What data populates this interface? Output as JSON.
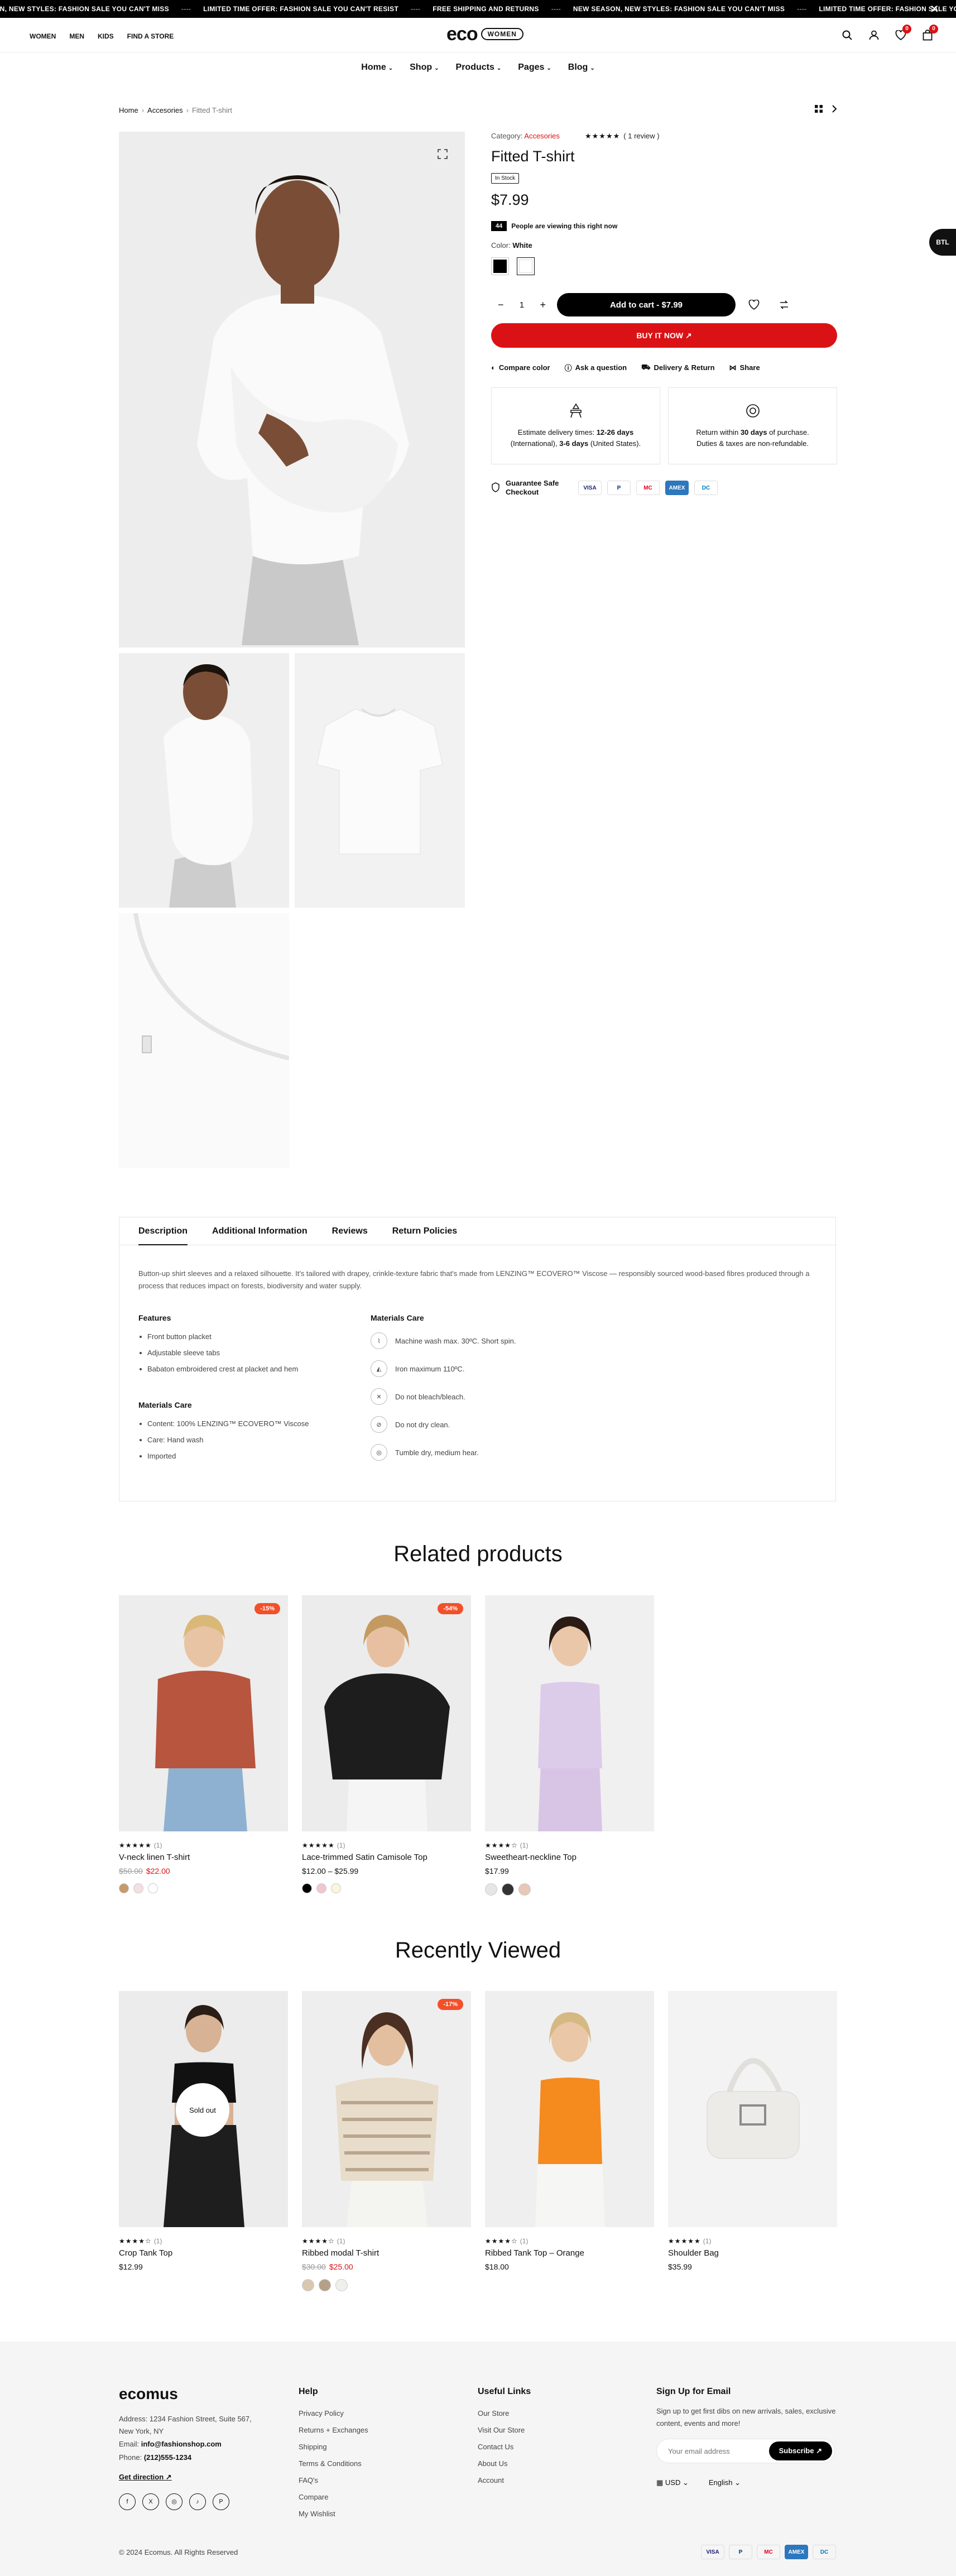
{
  "announcement": {
    "items": [
      "ON, NEW STYLES: FASHION SALE YOU CAN'T MISS",
      "LIMITED TIME OFFER: FASHION SALE YOU CAN'T RESIST",
      "FREE SHIPPING AND RETURNS",
      "NEW SEASON, NEW STYLES: FASHION SALE YOU CAN'T MISS",
      "LIMITED TIME OFFER: FASHION SALE YOU CAN'T"
    ],
    "separator": "----",
    "close": "✕"
  },
  "header": {
    "top_links": [
      "WOMEN",
      "MEN",
      "KIDS",
      "FIND A STORE"
    ],
    "logo_main": "eco",
    "logo_pill": "WOMEN",
    "wishlist_count": "0",
    "cart_count": "0"
  },
  "main_nav": [
    "Home",
    "Shop",
    "Products",
    "Pages",
    "Blog"
  ],
  "breadcrumb": {
    "home": "Home",
    "category": "Accesories",
    "current": "Fitted T-shirt"
  },
  "product": {
    "category_label": "Category:",
    "category": "Accesories",
    "stars": "★★★★★",
    "reviews": "( 1 review )",
    "title": "Fitted T-shirt",
    "stock": "In Stock",
    "price": "$7.99",
    "viewing_count": "44",
    "viewing_text": "People are viewing this right now",
    "color_label": "Color:",
    "color_value": "White",
    "colors": [
      "#000000",
      "#ffffff"
    ],
    "qty": "1",
    "add_to_cart": "Add to cart - $7.99",
    "buy_now": "BUY IT NOW",
    "extras": [
      "Compare color",
      "Ask a question",
      "Delivery & Return",
      "Share"
    ],
    "delivery_text_1": "Estimate delivery times:",
    "delivery_bold_1": "12-26 days",
    "delivery_text_2": "(International),",
    "delivery_bold_2": "3-6 days",
    "delivery_text_3": "(United States).",
    "return_text_1": "Return within",
    "return_bold": "30 days",
    "return_text_2": "of purchase. Duties & taxes are non-refundable.",
    "safe_checkout": "Guarantee Safe Checkout",
    "pay_cards": [
      "VISA",
      "P",
      "MC",
      "AMEX",
      "DC"
    ]
  },
  "side_badge": "BTL",
  "tabs": {
    "labels": [
      "Description",
      "Additional Information",
      "Reviews",
      "Return Policies"
    ],
    "description": "Button-up shirt sleeves and a relaxed silhouette. It's tailored with drapey, crinkle-texture fabric that's made from LENZING™ ECOVERO™ Viscose — responsibly sourced wood-based fibres produced through a process that reduces impact on forests, biodiversity and water supply.",
    "features_title": "Features",
    "features": [
      "Front button placket",
      "Adjustable sleeve tabs",
      "Babaton embroidered crest at placket and hem"
    ],
    "materials_title": "Materials Care",
    "materials": [
      "Content: 100% LENZING™ ECOVERO™ Viscose",
      "Care: Hand wash",
      "Imported"
    ],
    "care_title": "Materials Care",
    "care": [
      "Machine wash max. 30ºC. Short spin.",
      "Iron maximum 110ºC.",
      "Do not bleach/bleach.",
      "Do not dry clean.",
      "Tumble dry, medium hear."
    ]
  },
  "related": {
    "title": "Related products",
    "items": [
      {
        "name": "V-neck linen T-shirt",
        "stars": "★★★★★",
        "count": "(1)",
        "old": "$50.00",
        "price": "$22.00",
        "discount": "-15%"
      },
      {
        "name": "Lace-trimmed Satin Camisole Top",
        "stars": "★★★★★",
        "count": "(1)",
        "range": "$12.00 – $25.99",
        "discount": "-54%"
      },
      {
        "name": "Sweetheart-neckline Top",
        "stars": "★★★★☆",
        "count": "(1)",
        "price": "$17.99"
      }
    ]
  },
  "recent": {
    "title": "Recently Viewed",
    "items": [
      {
        "name": "Crop Tank Top",
        "stars": "★★★★☆",
        "count": "(1)",
        "price": "$12.99",
        "sold": "Sold out"
      },
      {
        "name": "Ribbed modal T-shirt",
        "stars": "★★★★☆",
        "count": "(1)",
        "old": "$30.00",
        "price": "$25.00",
        "discount": "-17%"
      },
      {
        "name": "Ribbed Tank Top – Orange",
        "stars": "★★★★☆",
        "count": "(1)",
        "price": "$18.00"
      },
      {
        "name": "Shoulder Bag",
        "stars": "★★★★★",
        "count": "(1)",
        "price": "$35.99"
      }
    ]
  },
  "footer": {
    "logo": "ecomus",
    "address": "Address: 1234 Fashion Street, Suite 567, New York, NY",
    "email_label": "Email:",
    "email": "info@fashionshop.com",
    "phone_label": "Phone:",
    "phone": "(212)555-1234",
    "direction": "Get direction",
    "help_title": "Help",
    "help": [
      "Privacy Policy",
      "Returns + Exchanges",
      "Shipping",
      "Terms & Conditions",
      "FAQ's",
      "Compare",
      "My Wishlist"
    ],
    "links_title": "Useful Links",
    "links": [
      "Our Store",
      "Visit Our Store",
      "Contact Us",
      "About Us",
      "Account"
    ],
    "signup_title": "Sign Up for Email",
    "signup_text": "Sign up to get first dibs on new arrivals, sales, exclusive content, events and more!",
    "email_placeholder": "Your email address",
    "subscribe": "Subscribe",
    "currency": "USD",
    "language": "English",
    "copyright": "© 2024 Ecomus. All Rights Reserved"
  }
}
